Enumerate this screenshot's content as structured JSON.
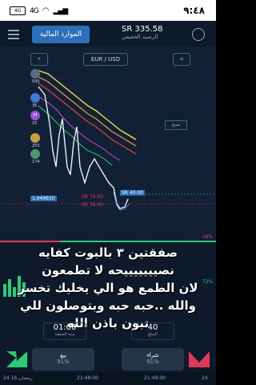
{
  "status": {
    "time": "٩:٤٨",
    "battery": "4G",
    "network": "4G"
  },
  "header": {
    "funds_label": "الموارد المالية",
    "balance": "SR 335.58",
    "balance_label": "الرصيد الحقيقي"
  },
  "chart": {
    "pair": "EUR / USD",
    "left_price_tag": "1.049610",
    "red_price": "SR 76.40",
    "red_price_2": "SR 76.40",
    "blue_price": "SR 40.00",
    "tag_label": "نسخ",
    "pct_label": "28%",
    "pct_label_2": "72%",
    "traders": [
      {
        "initials": "",
        "count": "500"
      },
      {
        "initials": "",
        "count": "35"
      },
      {
        "initials": "H",
        "count": "25"
      },
      {
        "initials": "",
        "count": "253"
      },
      {
        "initials": "",
        "count": "174"
      }
    ]
  },
  "caption_lines": [
    "صفقتين ٣ بالبوت كفايه",
    "نصيييييييحه لا تطمعون",
    "لان الطمع هو الي يخليك تخسر",
    "والله ..حبه حبه وبتوصلون للي",
    "تبون باذن الله"
  ],
  "trade": {
    "time_value": "01:00",
    "time_label": "مدة الصفقة",
    "amount_value": "40",
    "amount_label": "المبلغ",
    "sell_label": "بيع",
    "sell_pct": "91%",
    "buy_label": "شراء",
    "buy_pct": "91%"
  },
  "timeline": {
    "t1": "24 رمضان 16",
    "t2": "21:48:00",
    "t3": "21:49:00",
    "t4": "24"
  },
  "colors": {
    "accent": "#2d6fb8",
    "sell": "#e03a5a",
    "buy": "#2fc978",
    "line": "#f4e04d"
  }
}
